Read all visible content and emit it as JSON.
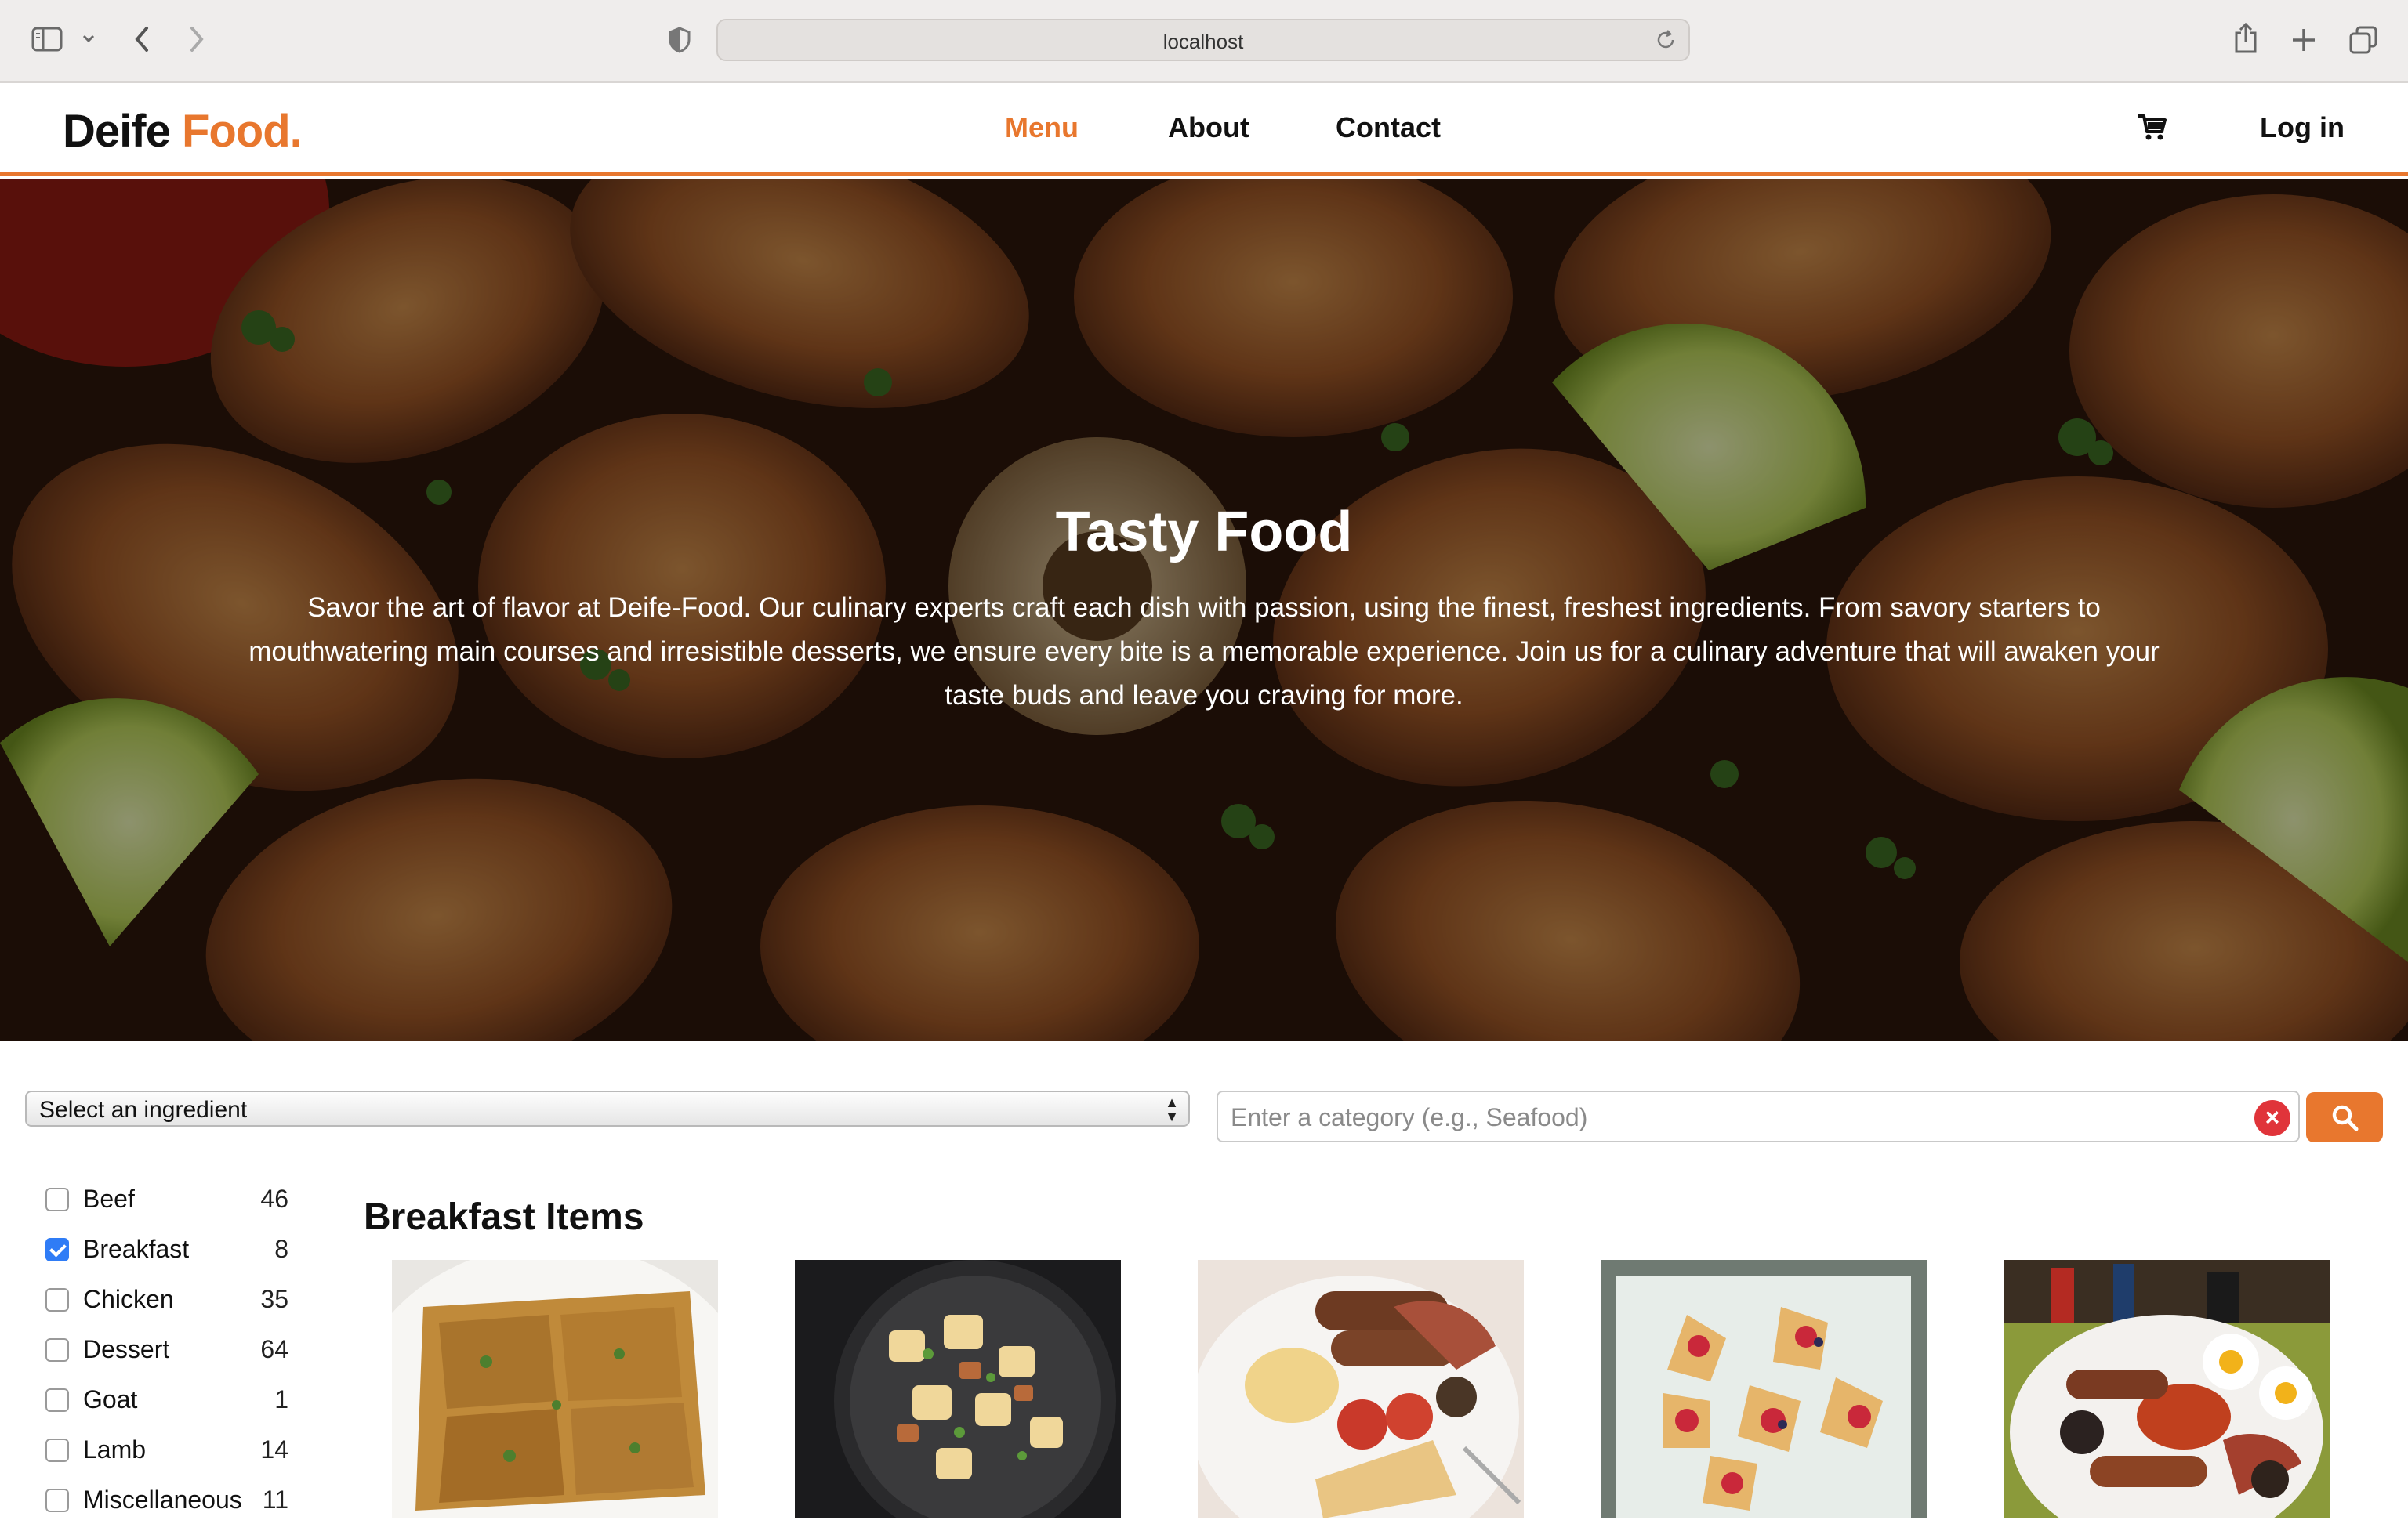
{
  "browser": {
    "url": "localhost",
    "icons": [
      "sidebar-icon",
      "chevron-down-icon",
      "back-icon",
      "forward-icon",
      "privacy-shield-icon",
      "reload-icon",
      "share-icon",
      "new-tab-icon",
      "tabs-overview-icon"
    ]
  },
  "header": {
    "logo_main": "Deife",
    "logo_accent": "Food.",
    "nav": [
      {
        "label": "Menu",
        "active": true
      },
      {
        "label": "About",
        "active": false
      },
      {
        "label": "Contact",
        "active": false
      }
    ],
    "cart_icon": "cart-icon",
    "login_label": "Log in",
    "accent_color": "#e8772e"
  },
  "hero": {
    "title": "Tasty Food",
    "text": "Savor the art of flavor at Deife-Food. Our culinary experts craft each dish with passion, using the finest, freshest ingredients. From savory starters to mouthwatering main courses and irresistible desserts, we ensure every bite is a memorable experience. Join us for a culinary adventure that will awaken your taste buds and leave you craving for more."
  },
  "filters": {
    "ingredient_select": "Select an ingredient",
    "category_placeholder": "Enter a category (e.g., Seafood)",
    "category_value": "",
    "clear_icon": "clear-icon",
    "search_icon": "search-icon"
  },
  "categories": [
    {
      "label": "Beef",
      "count": "46",
      "checked": false
    },
    {
      "label": "Breakfast",
      "count": "8",
      "checked": true
    },
    {
      "label": "Chicken",
      "count": "35",
      "checked": false
    },
    {
      "label": "Dessert",
      "count": "64",
      "checked": false
    },
    {
      "label": "Goat",
      "count": "1",
      "checked": false
    },
    {
      "label": "Lamb",
      "count": "14",
      "checked": false
    },
    {
      "label": "Miscellaneous",
      "count": "11",
      "checked": false
    }
  ],
  "main": {
    "section_title": "Breakfast Items",
    "items": [
      "breakfast-item-1",
      "breakfast-item-2",
      "breakfast-item-3",
      "breakfast-item-4",
      "breakfast-item-5"
    ]
  }
}
